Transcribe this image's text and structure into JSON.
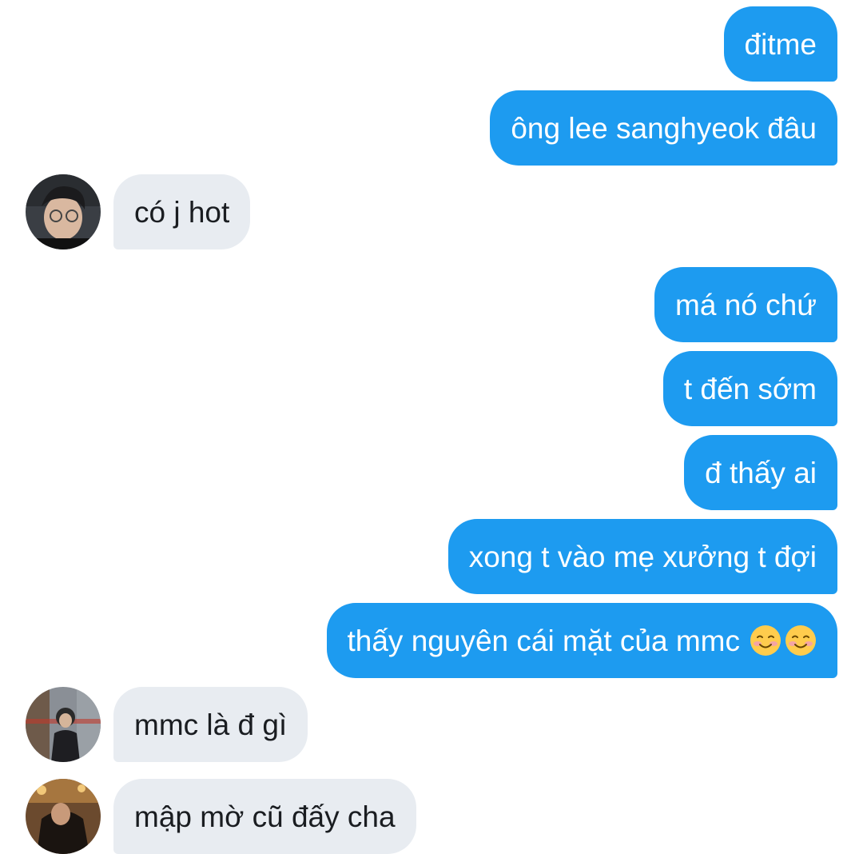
{
  "messages": {
    "m1": "đitme",
    "m2": "ông lee sanghyeok đâu",
    "m3": "có j hot",
    "m4": "má nó chứ",
    "m5": "t đến sớm",
    "m6": "đ thấy ai",
    "m7": "xong t vào mẹ xưởng t đợi",
    "m8": "thấy nguyên cái mặt của mmc",
    "m9": "mmc là đ gì",
    "m10": "mập mờ cũ đấy cha"
  },
  "icons": {
    "m8_emoji": "smiling-face-with-blush-icon"
  },
  "colors": {
    "sent_bubble": "#1d9bf0",
    "received_bubble": "#e8ecf1"
  }
}
